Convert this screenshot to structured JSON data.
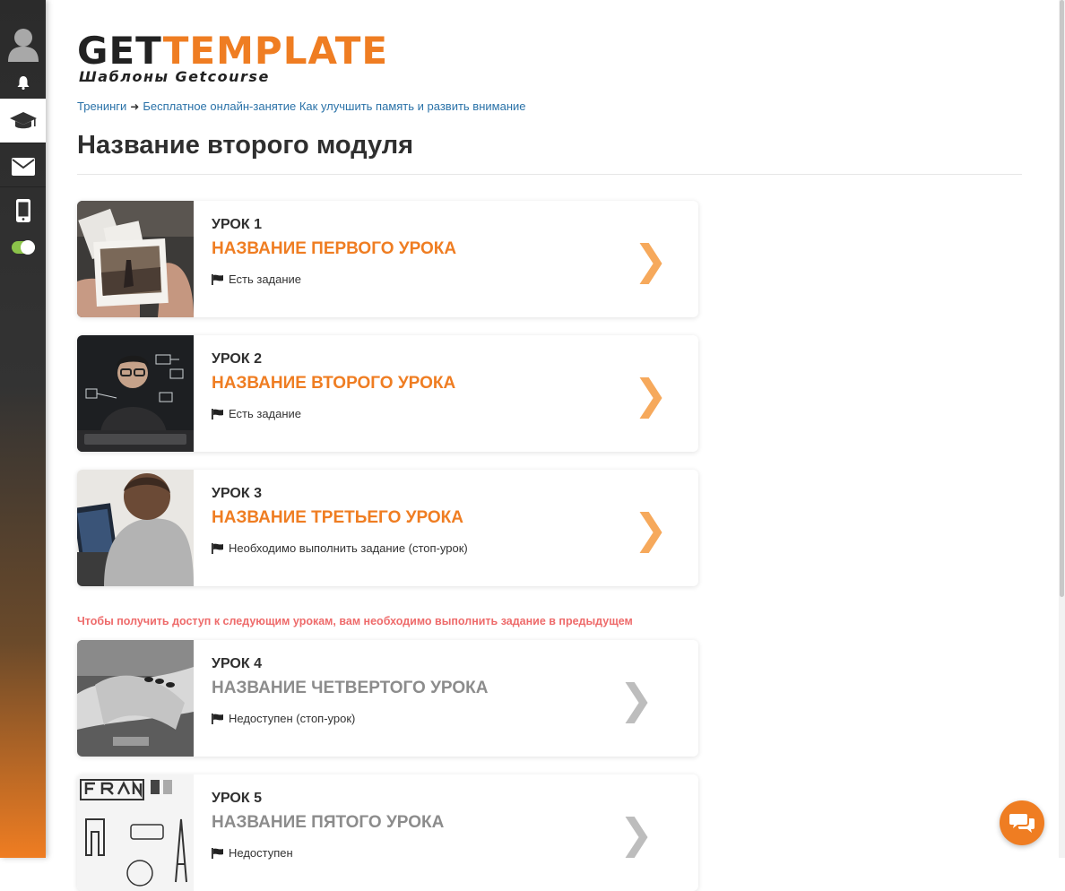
{
  "logo": {
    "main_a": "GET",
    "main_b": "TEMPLATE",
    "sub": "Шаблоны Getcourse"
  },
  "breadcrumb": {
    "root": "Тренинги",
    "current": "Бесплатное онлайн-занятие Как улучшить память и развить внимание"
  },
  "page_title": "Название второго модуля",
  "lessons": [
    {
      "number": "УРОК 1",
      "name": "НАЗВАНИЕ ПЕРВОГО УРОКА",
      "status": "Есть задание",
      "locked": false,
      "thumb": "photos-in-hand"
    },
    {
      "number": "УРОК 2",
      "name": "НАЗВАНИЕ ВТОРОГО УРОКА",
      "status": "Есть задание",
      "locked": false,
      "thumb": "man-at-keyboard"
    },
    {
      "number": "УРОК 3",
      "name": "НАЗВАНИЕ ТРЕТЬЕГО УРОКА",
      "status": "Необходимо выполнить задание (стоп-урок)",
      "locked": false,
      "thumb": "man-with-laptop"
    },
    {
      "number": "УРОК 4",
      "name": "НАЗВАНИЕ ЧЕТВЕРТОГО УРОКА",
      "status": "Недоступен (стоп-урок)",
      "locked": true,
      "thumb": "holding-hands"
    },
    {
      "number": "УРОК 5",
      "name": "НАЗВАНИЕ ПЯТОГО УРОКА",
      "status": "Недоступен",
      "locked": true,
      "thumb": "france-doodle"
    }
  ],
  "lock_warning": "Чтобы получить доступ к следующим урокам, вам необходимо выполнить задание в предыдущем",
  "sidebar": {
    "items": [
      "avatar",
      "bell-icon",
      "graduation-cap-icon",
      "mail-icon",
      "mobile-icon",
      "toggle"
    ]
  },
  "colors": {
    "accent": "#ef7d22",
    "link": "#2a72a8",
    "warning": "#ee6b6b",
    "locked": "#8c8c8c"
  }
}
